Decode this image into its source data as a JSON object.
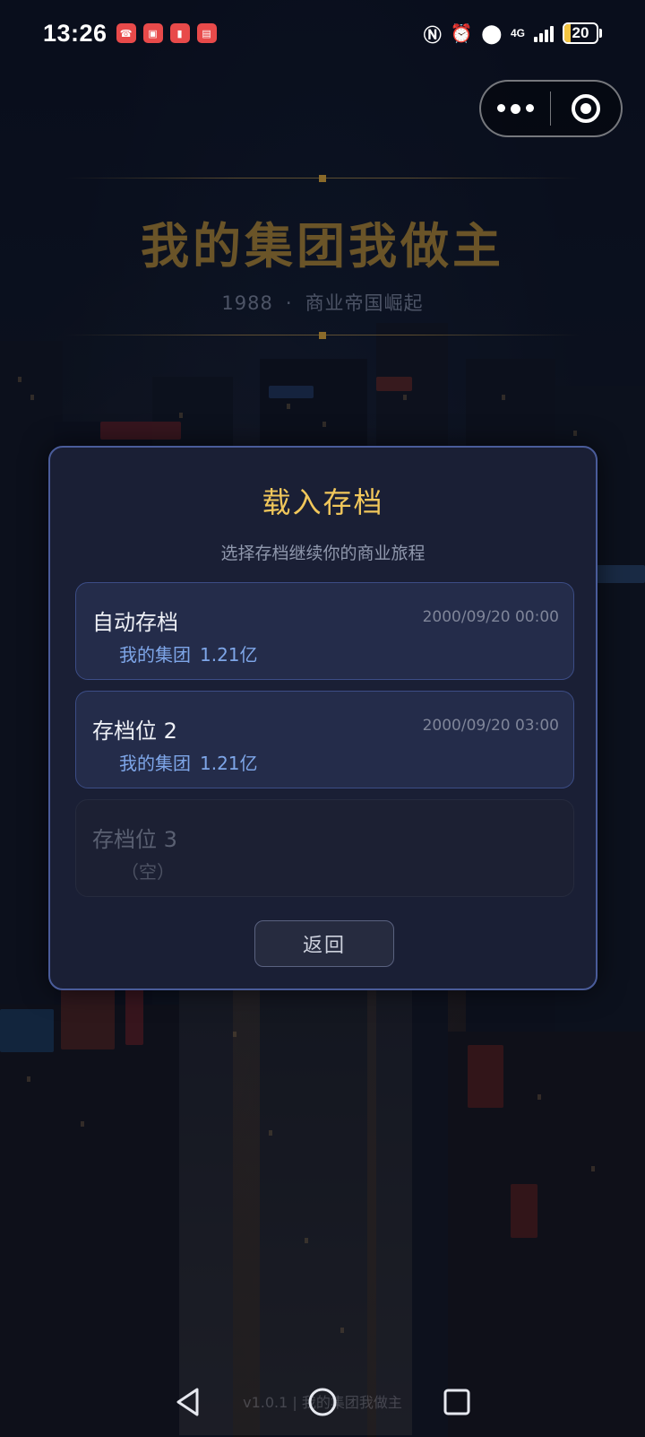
{
  "status_bar": {
    "time": "13:26",
    "network": "4G",
    "battery": "20"
  },
  "header": {
    "game_title": "我的集团我做主",
    "year": "1988",
    "separator": "·",
    "tagline": "商业帝国崛起"
  },
  "modal": {
    "title": "载入存档",
    "subtitle": "选择存档继续你的商业旅程",
    "slots": [
      {
        "name": "自动存档",
        "time": "2000/09/20 00:00",
        "company": "我的集团",
        "money": "1.21亿"
      },
      {
        "name": "存档位 2",
        "time": "2000/09/20 03:00",
        "company": "我的集团",
        "money": "1.21亿"
      },
      {
        "name": "存档位 3",
        "empty_label": "（空）"
      }
    ],
    "back_label": "返回"
  },
  "footer": {
    "faded_text": "v1.0.1 | 我的集团我做主"
  },
  "colors": {
    "accent_gold": "#f1c75b",
    "modal_border": "#4a5c9a",
    "info_blue": "#7ea6e8"
  }
}
